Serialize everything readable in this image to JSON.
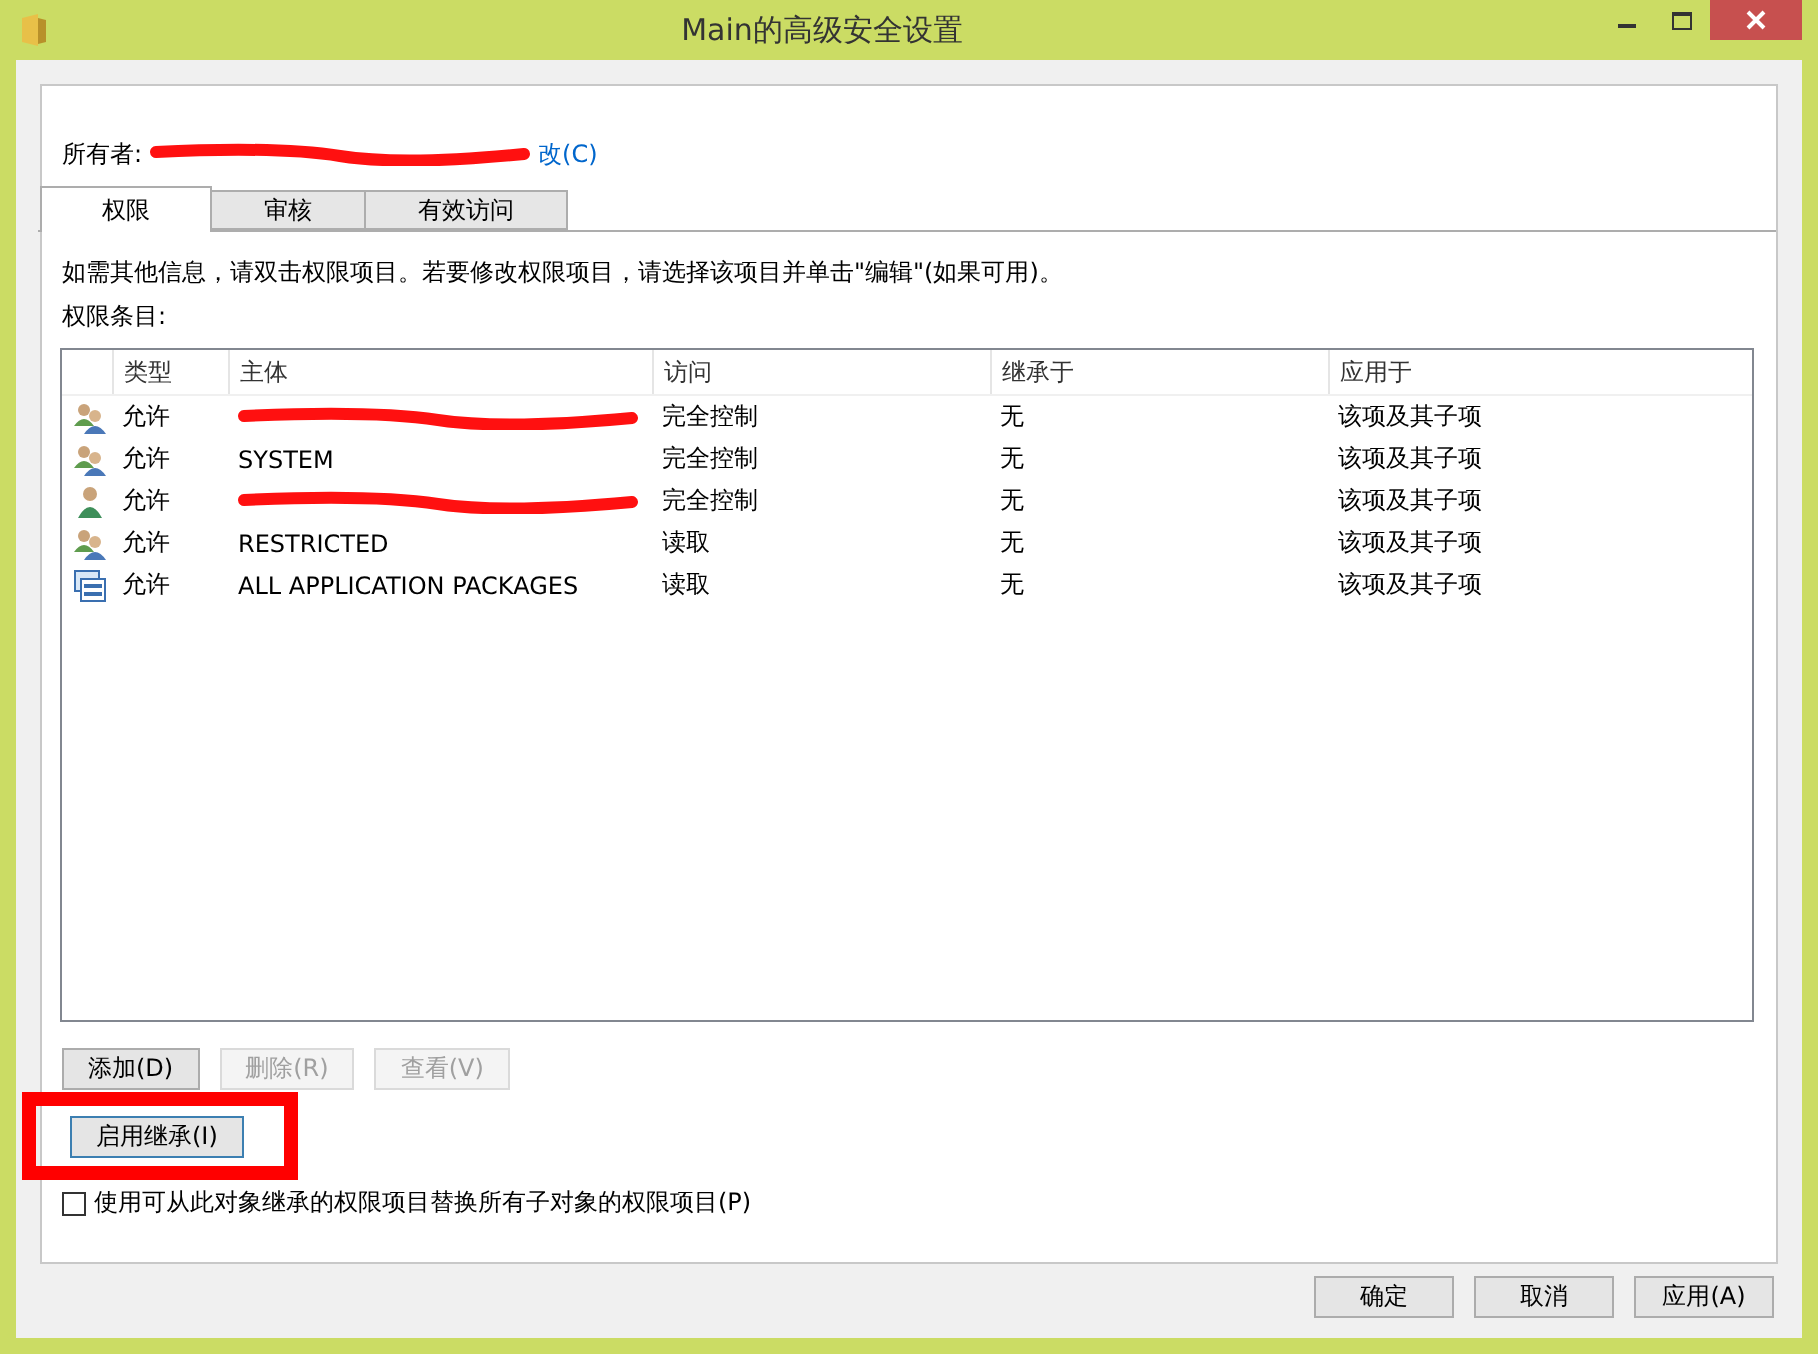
{
  "window": {
    "title": "Main的高级安全设置"
  },
  "owner": {
    "label": "所有者:",
    "redacted": true,
    "change_link": "改(C)"
  },
  "tabs": [
    {
      "label": "权限",
      "selected": true
    },
    {
      "label": "审核",
      "selected": false
    },
    {
      "label": "有效访问",
      "selected": false
    }
  ],
  "info_text": "如需其他信息，请双击权限项目。若要修改权限项目，请选择该项目并单击\"编辑\"(如果可用)。",
  "entries_label": "权限条目:",
  "table": {
    "columns": [
      "类型",
      "主体",
      "访问",
      "继承于",
      "应用于"
    ],
    "rows": [
      {
        "kind": "group",
        "type": "允许",
        "principal_redacted": true,
        "access": "完全控制",
        "inherited_from": "无",
        "applies_to": "该项及其子项"
      },
      {
        "kind": "group",
        "type": "允许",
        "principal": "SYSTEM",
        "access": "完全控制",
        "inherited_from": "无",
        "applies_to": "该项及其子项"
      },
      {
        "kind": "user",
        "type": "允许",
        "principal_redacted": true,
        "access": "完全控制",
        "inherited_from": "无",
        "applies_to": "该项及其子项"
      },
      {
        "kind": "group",
        "type": "允许",
        "principal": "RESTRICTED",
        "access": "读取",
        "inherited_from": "无",
        "applies_to": "该项及其子项"
      },
      {
        "kind": "package",
        "type": "允许",
        "principal": "ALL APPLICATION PACKAGES",
        "access": "读取",
        "inherited_from": "无",
        "applies_to": "该项及其子项"
      }
    ]
  },
  "entry_buttons": [
    {
      "label": "添加(D)",
      "disabled": false
    },
    {
      "label": "删除(R)",
      "disabled": true
    },
    {
      "label": "查看(V)",
      "disabled": true
    }
  ],
  "inherit_button": {
    "label": "启用继承(I)",
    "highlighted": true
  },
  "replace_checkbox": {
    "label": "使用可从此对象继承的权限项目替换所有子对象的权限项目(P)",
    "checked": false
  },
  "dialog_buttons": [
    "确定",
    "取消",
    "应用(A)"
  ]
}
